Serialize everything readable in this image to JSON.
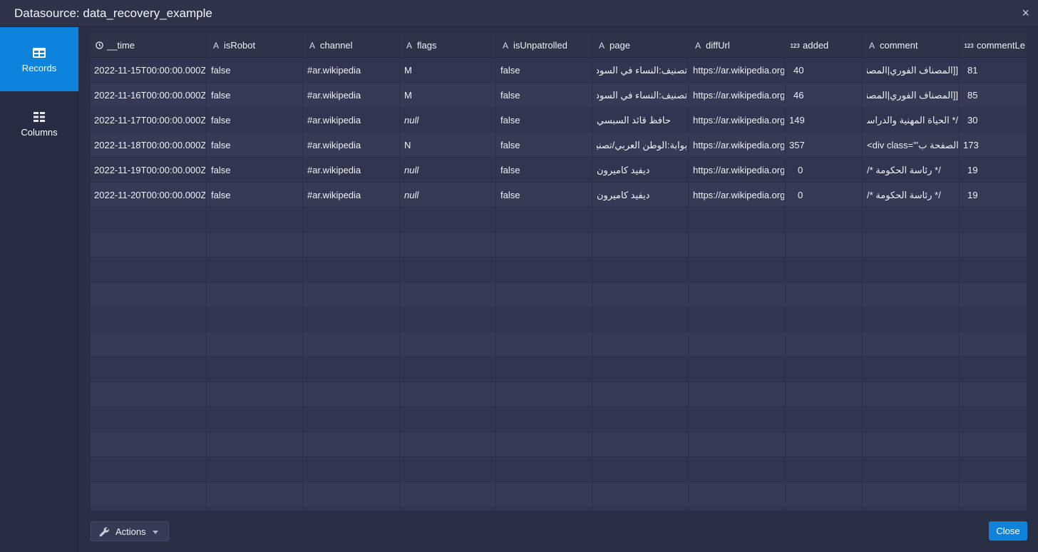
{
  "window": {
    "title": "Datasource: data_recovery_example",
    "close_glyph": "×"
  },
  "sidebar": {
    "items": [
      {
        "label": "Records",
        "icon": "table-icon",
        "active": true
      },
      {
        "label": "Columns",
        "icon": "columns-list-icon",
        "active": false
      }
    ]
  },
  "table": {
    "columns": [
      {
        "label": "__time",
        "type_icon": "clock-icon"
      },
      {
        "label": "isRobot",
        "type_icon": "A"
      },
      {
        "label": "channel",
        "type_icon": "A"
      },
      {
        "label": "flags",
        "type_icon": "A"
      },
      {
        "label": "isUnpatrolled",
        "type_icon": "A"
      },
      {
        "label": "page",
        "type_icon": "A"
      },
      {
        "label": "diffUrl",
        "type_icon": "A"
      },
      {
        "label": "added",
        "type_icon": "123"
      },
      {
        "label": "comment",
        "type_icon": "A"
      },
      {
        "label": "commentLe...",
        "type_icon": "123"
      }
    ],
    "rows": [
      [
        "2022-11-15T00:00:00.000Z",
        "false",
        "#ar.wikipedia",
        "M",
        "false",
        "تصنيف:النساء في السودان",
        "https://ar.wikipedia.org/",
        "40",
        "[[المصناف الفوري|المصناف الفوري]]",
        "81"
      ],
      [
        "2022-11-16T00:00:00.000Z",
        "false",
        "#ar.wikipedia",
        "M",
        "false",
        "تصنيف:النساء في السودان",
        "https://ar.wikipedia.org/",
        "46",
        "[[المصناف الفوري|المصناف الفوري]]",
        "85"
      ],
      [
        "2022-11-17T00:00:00.000Z",
        "false",
        "#ar.wikipedia",
        "null",
        "false",
        "حافظ قائد السبسي",
        "https://ar.wikipedia.org/",
        "149",
        "/* الحياة المهنية والدراسية */",
        "30"
      ],
      [
        "2022-11-18T00:00:00.000Z",
        "false",
        "#ar.wikipedia",
        "N",
        "false",
        "بوابة:الوطن العربي/تصنيف/فلسطين",
        "https://ar.wikipedia.org/",
        "357",
        "<div class=\"'أنشأ الصفحة ب",
        "173"
      ],
      [
        "2022-11-19T00:00:00.000Z",
        "false",
        "#ar.wikipedia",
        "null",
        "false",
        "ديفيد كاميرون",
        "https://ar.wikipedia.org/",
        "0",
        "/* رئاسة الحكومة */",
        "19"
      ],
      [
        "2022-11-20T00:00:00.000Z",
        "false",
        "#ar.wikipedia",
        "null",
        "false",
        "ديفيد كاميرون",
        "https://ar.wikipedia.org/",
        "0",
        "/* رئاسة الحكومة */",
        "19"
      ]
    ]
  },
  "footer": {
    "actions_label": "Actions",
    "close_label": "Close"
  },
  "colors": {
    "accent": "#0d83dc",
    "background": "#2a2f45"
  }
}
